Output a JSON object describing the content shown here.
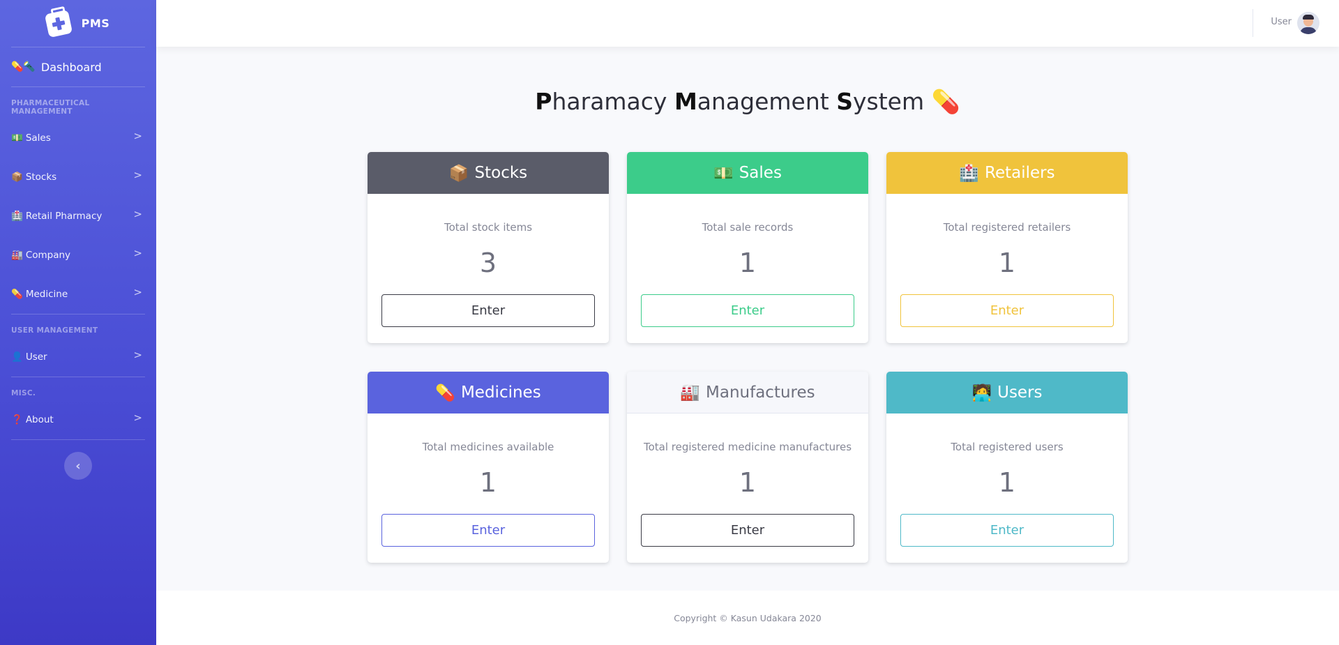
{
  "brand": {
    "name": "PMS"
  },
  "sidebar": {
    "dashboard": {
      "emoji": "💊🔦",
      "label": "Dashboard"
    },
    "sections": [
      {
        "heading": "PHARMACEUTICAL MANAGEMENT",
        "items": [
          {
            "emoji": "💵",
            "label": "Sales"
          },
          {
            "emoji": "📦",
            "label": "Stocks"
          },
          {
            "emoji": "🏥",
            "label": "Retail Pharmacy"
          },
          {
            "emoji": "🏭",
            "label": "Company"
          },
          {
            "emoji": "💊",
            "label": "Medicine"
          }
        ]
      },
      {
        "heading": "USER MANAGEMENT",
        "items": [
          {
            "emoji": "👤",
            "label": "User"
          }
        ]
      },
      {
        "heading": "MISC.",
        "items": [
          {
            "emoji": "❓",
            "label": "About"
          }
        ]
      }
    ],
    "arrow": ">",
    "toggle": "‹"
  },
  "topbar": {
    "user_label": "User"
  },
  "title": {
    "p1_cap": "P",
    "p1_rest": "haramacy ",
    "p2_cap": "M",
    "p2_rest": "anagement ",
    "p3_cap": "S",
    "p3_rest": "ystem",
    "emoji": "💊"
  },
  "cards": [
    {
      "emoji": "📦",
      "title": "Stocks",
      "subtitle": "Total stock items",
      "count": "3",
      "button": "Enter",
      "header_bg": "#5a5c69",
      "header_color": "#ffffff",
      "btn_color": "#3a3b45"
    },
    {
      "emoji": "💵",
      "title": "Sales",
      "subtitle": "Total sale records",
      "count": "1",
      "button": "Enter",
      "header_bg": "#3ccc8a",
      "header_color": "#ffffff",
      "btn_color": "#3ccc8a"
    },
    {
      "emoji": "🏥",
      "title": "Retailers",
      "subtitle": "Total registered retailers",
      "count": "1",
      "button": "Enter",
      "header_bg": "#f0c33c",
      "header_color": "#ffffff",
      "btn_color": "#f0c33c"
    },
    {
      "emoji": "💊",
      "title": "Medicines",
      "subtitle": "Total medicines available",
      "count": "1",
      "button": "Enter",
      "header_bg": "#5a63de",
      "header_color": "#ffffff",
      "btn_color": "#5a63de"
    },
    {
      "emoji": "🏭",
      "title": "Manufactures",
      "subtitle": "Total registered medicine manufactures",
      "count": "1",
      "button": "Enter",
      "header_bg": "#f6f7fb",
      "header_color": "#6e707e",
      "btn_color": "#3a3b45"
    },
    {
      "emoji": "🧑‍💻",
      "title": "Users",
      "subtitle": "Total registered users",
      "count": "1",
      "button": "Enter",
      "header_bg": "#4fb9c8",
      "header_color": "#ffffff",
      "btn_color": "#4fb9c8"
    }
  ],
  "footer": {
    "copyright": "Copyright © Kasun Udakara 2020"
  }
}
